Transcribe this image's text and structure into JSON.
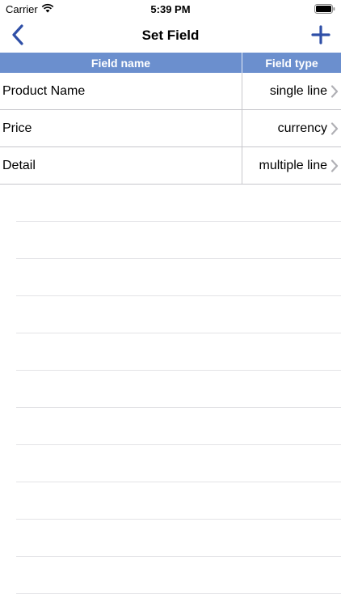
{
  "status_bar": {
    "carrier": "Carrier",
    "time": "5:39 PM"
  },
  "nav": {
    "title": "Set Field",
    "back_icon": "chevron-left-icon",
    "add_icon": "plus-icon",
    "tint_color": "#2f4fa7"
  },
  "table": {
    "header_color": "#6b8fce",
    "columns": {
      "name": "Field name",
      "type": "Field type"
    },
    "rows": [
      {
        "name": "Product Name",
        "type": "single line"
      },
      {
        "name": "Price",
        "type": "currency"
      },
      {
        "name": "Detail",
        "type": "multiple line"
      }
    ]
  }
}
